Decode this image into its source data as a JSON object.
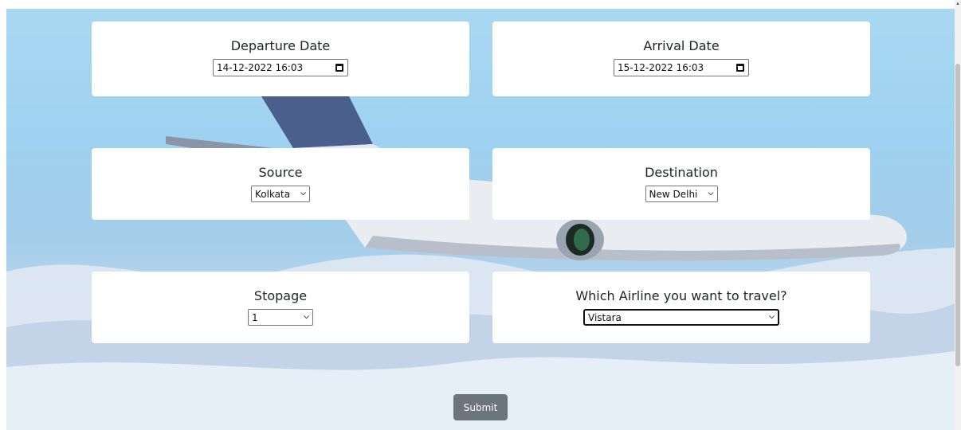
{
  "form": {
    "departure": {
      "label": "Departure Date",
      "value": "14-12-2022 16:03"
    },
    "arrival": {
      "label": "Arrival Date",
      "value": "15-12-2022 16:03"
    },
    "source": {
      "label": "Source",
      "value": "Kolkata"
    },
    "destination": {
      "label": "Destination",
      "value": "New Delhi"
    },
    "stopage": {
      "label": "Stopage",
      "value": "1"
    },
    "airline": {
      "label": "Which Airline you want to travel?",
      "value": "Vistara"
    },
    "submit_label": "Submit"
  },
  "icons": {
    "calendar": "calendar-icon",
    "dropdown": "chevron-down-icon"
  },
  "colors": {
    "submit_bg": "#6c757d",
    "card_bg": "#ffffff"
  }
}
